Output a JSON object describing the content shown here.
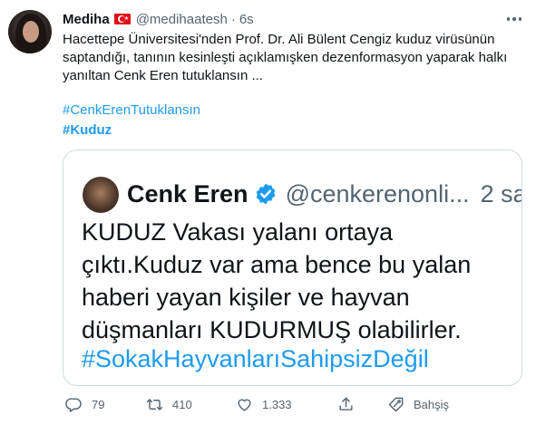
{
  "tweet": {
    "author_name": "Mediha",
    "author_handle": "@medihaatesh",
    "separator": "·",
    "time": "6s",
    "text_lines": [
      "Hacettepe Üniversitesi'nden Prof. Dr. Ali Bülent Cengiz kuduz virüsünün",
      "saptandığı, tanının kesinleşti açıklamışken dezenformasyon yaparak halkı",
      "yanıltan Cenk Eren tutuklansın ..."
    ],
    "hashtags": [
      "#CenkErenTutuklansın",
      "#Kuduz"
    ]
  },
  "quoted": {
    "author_name": "Cenk Eren",
    "author_handle": "@cenkerenonli...",
    "time": "2 sa",
    "text_lines": [
      "KUDUZ Vakası yalanı ortaya",
      "çıktı.Kuduz var ama bence bu yalan",
      "haberi yayan kişiler ve hayvan",
      "düşmanları KUDURMUŞ olabilirler."
    ],
    "hashtag": "#SokakHayvanlarıSahipsizDeğil"
  },
  "actions": {
    "reply_count": "79",
    "retweet_count": "410",
    "like_count": "1.333",
    "tip_label": "Bahşiş"
  },
  "icons": {
    "more": "more-horizontal-icon",
    "reply": "reply-icon",
    "retweet": "retweet-icon",
    "like": "heart-icon",
    "share": "share-icon",
    "tip": "tip-icon",
    "verified": "verified-badge-icon",
    "flag": "turkey-flag-icon"
  },
  "colors": {
    "link": "#1d9bf0",
    "secondary_text": "#536471",
    "border": "#cfd9de",
    "flag_red": "#e30a17"
  }
}
